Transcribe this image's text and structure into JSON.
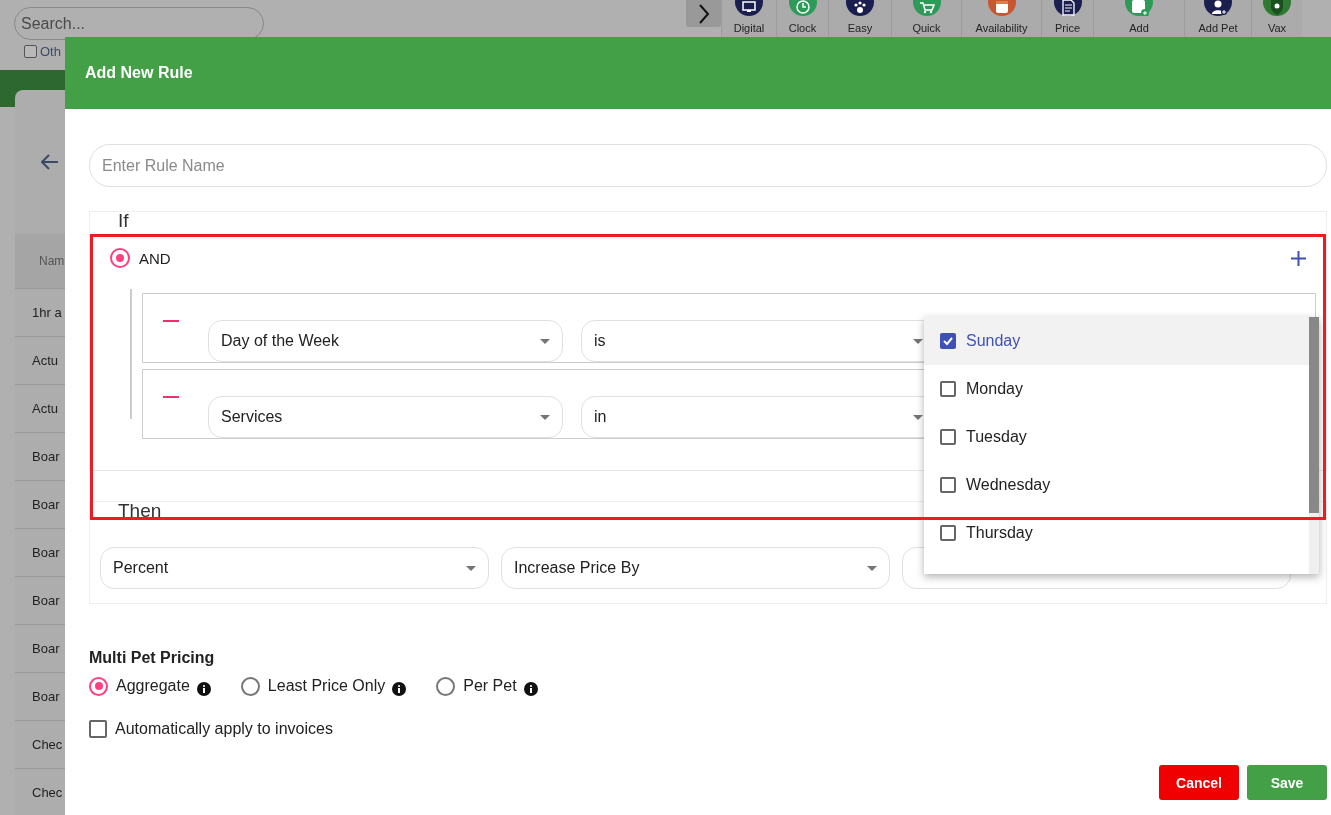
{
  "background": {
    "search": {
      "placeholder": "Search..."
    },
    "filter_checkbox": {
      "label": "Oth",
      "checked": false
    },
    "toolbar": {
      "items": [
        "Digital",
        "Clock",
        "Easy",
        "Quick",
        "Availability",
        "Price",
        "Add",
        "Add Pet",
        "Vax"
      ]
    },
    "table": {
      "column_1": "Nam",
      "rows": [
        "1hr a",
        "Actu",
        "Actu",
        "Boar",
        "Boar",
        "Boar",
        "Boar",
        "Boar",
        "Boar",
        "Chec",
        "Chec"
      ]
    }
  },
  "dialog": {
    "title": "Add New Rule",
    "rule_name": {
      "placeholder": "Enter Rule Name"
    },
    "if": {
      "label": "If",
      "operator": {
        "label": "AND",
        "selected": true
      },
      "conditions": [
        {
          "field": "Day of the Week",
          "comparator": "is"
        },
        {
          "field": "Services",
          "comparator": "in"
        }
      ]
    },
    "day_menu": {
      "options": [
        {
          "label": "Sunday",
          "checked": true
        },
        {
          "label": "Monday",
          "checked": false
        },
        {
          "label": "Tuesday",
          "checked": false
        },
        {
          "label": "Wednesday",
          "checked": false
        },
        {
          "label": "Thursday",
          "checked": false
        }
      ]
    },
    "then": {
      "label": "Then",
      "selects": [
        "Percent",
        "Increase Price By"
      ]
    },
    "multi_pet_pricing": {
      "label": "Multi Pet Pricing",
      "options": [
        {
          "label": "Aggregate",
          "selected": true
        },
        {
          "label": "Least Price Only",
          "selected": false
        },
        {
          "label": "Per Pet",
          "selected": false
        }
      ]
    },
    "auto_apply": {
      "label": "Automatically apply to invoices",
      "checked": false
    },
    "buttons": [
      {
        "label": "Cancel",
        "kind": "danger"
      },
      {
        "label": "Save",
        "kind": "primary"
      }
    ]
  }
}
